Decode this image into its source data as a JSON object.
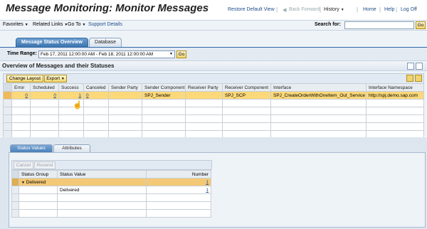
{
  "header": {
    "title": "Message Monitoring: Monitor Messages",
    "restore_default_view": "Restore Default View",
    "back": "◀",
    "back_forward": "Back Forward",
    "history": "History",
    "home": "Home",
    "help": "Help",
    "log_off": "Log Off",
    "sep": "|"
  },
  "menubar": {
    "favorites": "Favorites",
    "related_links": "Related Links",
    "go_to": "Go To",
    "support_details": "Support Details",
    "search_label": "Search for:",
    "search_value": "",
    "go_label": "Go"
  },
  "tabs": [
    {
      "label": "Message Status Overview"
    },
    {
      "label": "Database"
    }
  ],
  "time_range": {
    "label": "Time Range:",
    "value": "Feb 17, 2011 12:00:00 AM - Feb 18, 2011 12:00:00 AM",
    "go_label": "Go"
  },
  "overview": {
    "title": "Overview of Messages and their Statuses",
    "change_layout": "Change Layout",
    "export": "Export"
  },
  "message_table": {
    "columns": [
      "Error",
      "Scheduled",
      "Success",
      "Canceled",
      "Sender Party",
      "Sender Component",
      "Receiver Party",
      "Receiver Component",
      "Interface",
      "Interface Namespace"
    ],
    "rows": [
      {
        "error": "0",
        "scheduled": "0",
        "success": "1",
        "canceled": "0",
        "sender_party": "",
        "sender_component": "SPJ_Sender",
        "receiver_party": "",
        "receiver_component": "SPJ_SCP",
        "interface": "SPJ_CreateOrderWithOneItem_Out_Service",
        "interface_namespace": "http://spj.demo.sap.com"
      }
    ]
  },
  "lower": {
    "tabs": [
      {
        "label": "Status Values"
      },
      {
        "label": "Attributes"
      }
    ],
    "cancel": "Cancel",
    "resend": "Resend",
    "columns": [
      "Status Group",
      "Status Value",
      "Number"
    ],
    "group_label": "Delivered",
    "group_number": "1",
    "row_value": "Delivered",
    "row_number": "1"
  },
  "colors": {
    "selected_row": "#fbd879",
    "accent_blue": "#2e6aa6",
    "link": "#1f4d8a"
  }
}
